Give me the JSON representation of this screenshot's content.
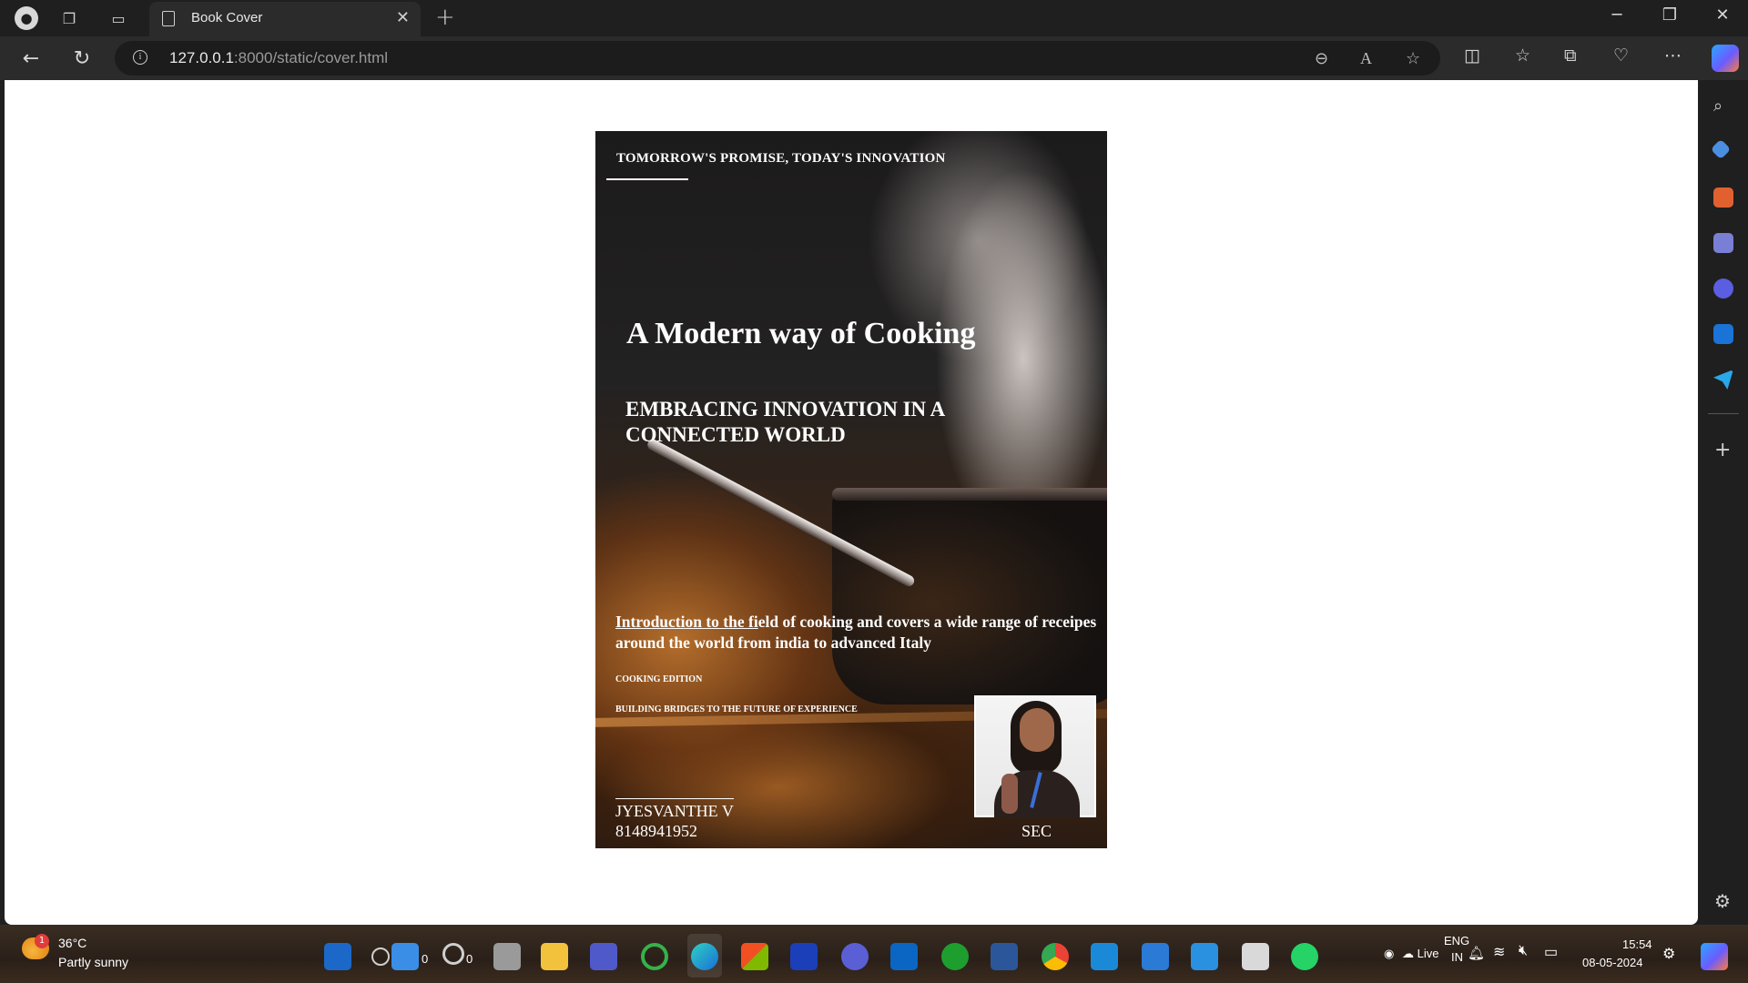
{
  "browser": {
    "tab_title": "Book Cover",
    "url_host": "127.0.0.1",
    "url_rest": ":8000/static/cover.html"
  },
  "cover": {
    "tagline": "TOMORROW'S PROMISE, TODAY'S INNOVATION",
    "title": "A Modern way of Cooking",
    "subtitle": "EMBRACING INNOVATION IN A CONNECTED WORLD",
    "intro_underlined": "Introduction to the fi",
    "intro_rest": "eld of cooking and covers a wide range of receipes around the world from india to advanced Italy",
    "edition": "COOKING EDITION",
    "bridges": "BUILDING BRIDGES TO THE FUTURE OF EXPERIENCE",
    "author": "JYESVANTHE V",
    "phone": "8148941952",
    "org": "SEC"
  },
  "taskbar": {
    "temperature": "36°C",
    "condition": "Partly sunny",
    "weather_badge": "1",
    "count_a": "0",
    "count_b": "0",
    "tray_live": "Live",
    "lang_top": "ENG",
    "lang_bottom": "IN",
    "time": "15:54",
    "date": "08-05-2024"
  },
  "colors": {
    "chrome_dark": "#1f1f1f",
    "page_bg": "#ffffff",
    "cover_text": "#ffffff"
  }
}
